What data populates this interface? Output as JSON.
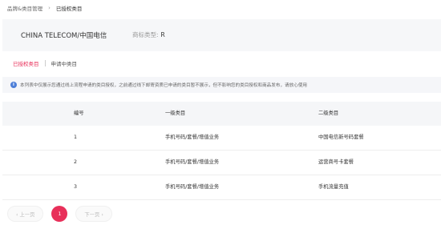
{
  "breadcrumb": {
    "parent": "品牌&类目管理",
    "separator": "›",
    "current": "已授权类目"
  },
  "brand": {
    "name": "CHINA TELECOM/中国电信",
    "type_label": "商标类型:",
    "type_value": "R"
  },
  "tabs": [
    {
      "label": "已授权类目",
      "active": true
    },
    {
      "label": "申请中类目",
      "active": false
    }
  ],
  "notice": {
    "text": "本列表中仅展示您通过线上流程申请的类目授权，之前通过线下邮寄资质已申请的类目暂不展示，但不影响您的类目授权和商品发布，请放心使用"
  },
  "table": {
    "headers": [
      "编号",
      "一级类目",
      "二级类目"
    ],
    "rows": [
      [
        "1",
        "手机号码/套餐/增值业务",
        "中国电信新号码套餐"
      ],
      [
        "2",
        "手机号码/套餐/增值业务",
        "运营商号卡套餐"
      ],
      [
        "3",
        "手机号码/套餐/增值业务",
        "手机流量充值"
      ]
    ]
  },
  "pagination": {
    "prev": "‹ 上一页",
    "current": "1",
    "next": "下一页 ›"
  },
  "colors": {
    "accent": "#e8305a",
    "info": "#4e7fd8"
  }
}
